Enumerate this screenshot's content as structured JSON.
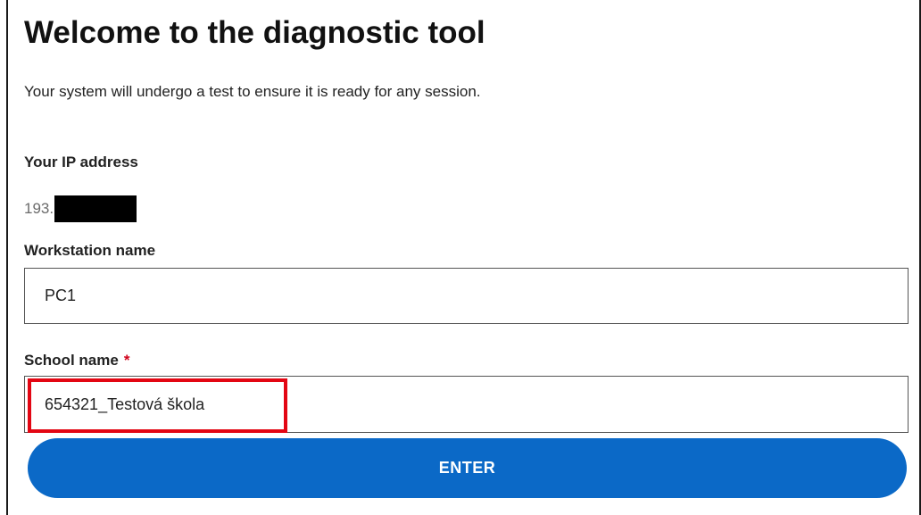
{
  "header": {
    "title": "Welcome to the diagnostic tool",
    "subtitle": "Your system will undergo a test to ensure it is ready for any session."
  },
  "ip": {
    "label": "Your IP address",
    "value_prefix": "193."
  },
  "workstation": {
    "label": "Workstation name",
    "value": "PC1"
  },
  "school": {
    "label": "School name",
    "required_mark": "*",
    "value": "654321_Testová škola"
  },
  "actions": {
    "enter_label": "ENTER"
  },
  "colors": {
    "accent": "#0b69c7",
    "required": "#d0021b",
    "highlight": "#e30613"
  }
}
